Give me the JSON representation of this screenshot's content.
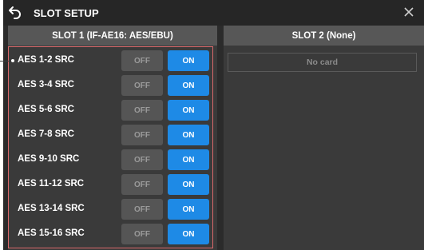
{
  "window": {
    "title": "SLOT SETUP"
  },
  "slot1": {
    "header": "SLOT 1 (IF-AE16: AES/EBU)",
    "rows": [
      {
        "label": "AES 1-2 SRC",
        "off_label": "OFF",
        "on_label": "ON",
        "state": "ON"
      },
      {
        "label": "AES 3-4 SRC",
        "off_label": "OFF",
        "on_label": "ON",
        "state": "ON"
      },
      {
        "label": "AES 5-6 SRC",
        "off_label": "OFF",
        "on_label": "ON",
        "state": "ON"
      },
      {
        "label": "AES 7-8 SRC",
        "off_label": "OFF",
        "on_label": "ON",
        "state": "ON"
      },
      {
        "label": "AES 9-10 SRC",
        "off_label": "OFF",
        "on_label": "ON",
        "state": "ON"
      },
      {
        "label": "AES 11-12 SRC",
        "off_label": "OFF",
        "on_label": "ON",
        "state": "ON"
      },
      {
        "label": "AES 13-14 SRC",
        "off_label": "OFF",
        "on_label": "ON",
        "state": "ON"
      },
      {
        "label": "AES 15-16 SRC",
        "off_label": "OFF",
        "on_label": "ON",
        "state": "ON"
      }
    ]
  },
  "slot2": {
    "header": "SLOT 2 (None)",
    "status": "No card"
  },
  "colors": {
    "accent_on": "#1e8ae6",
    "highlight_border": "#d9686b"
  },
  "icons": {
    "back": "back-arrow-icon",
    "close": "close-icon"
  }
}
